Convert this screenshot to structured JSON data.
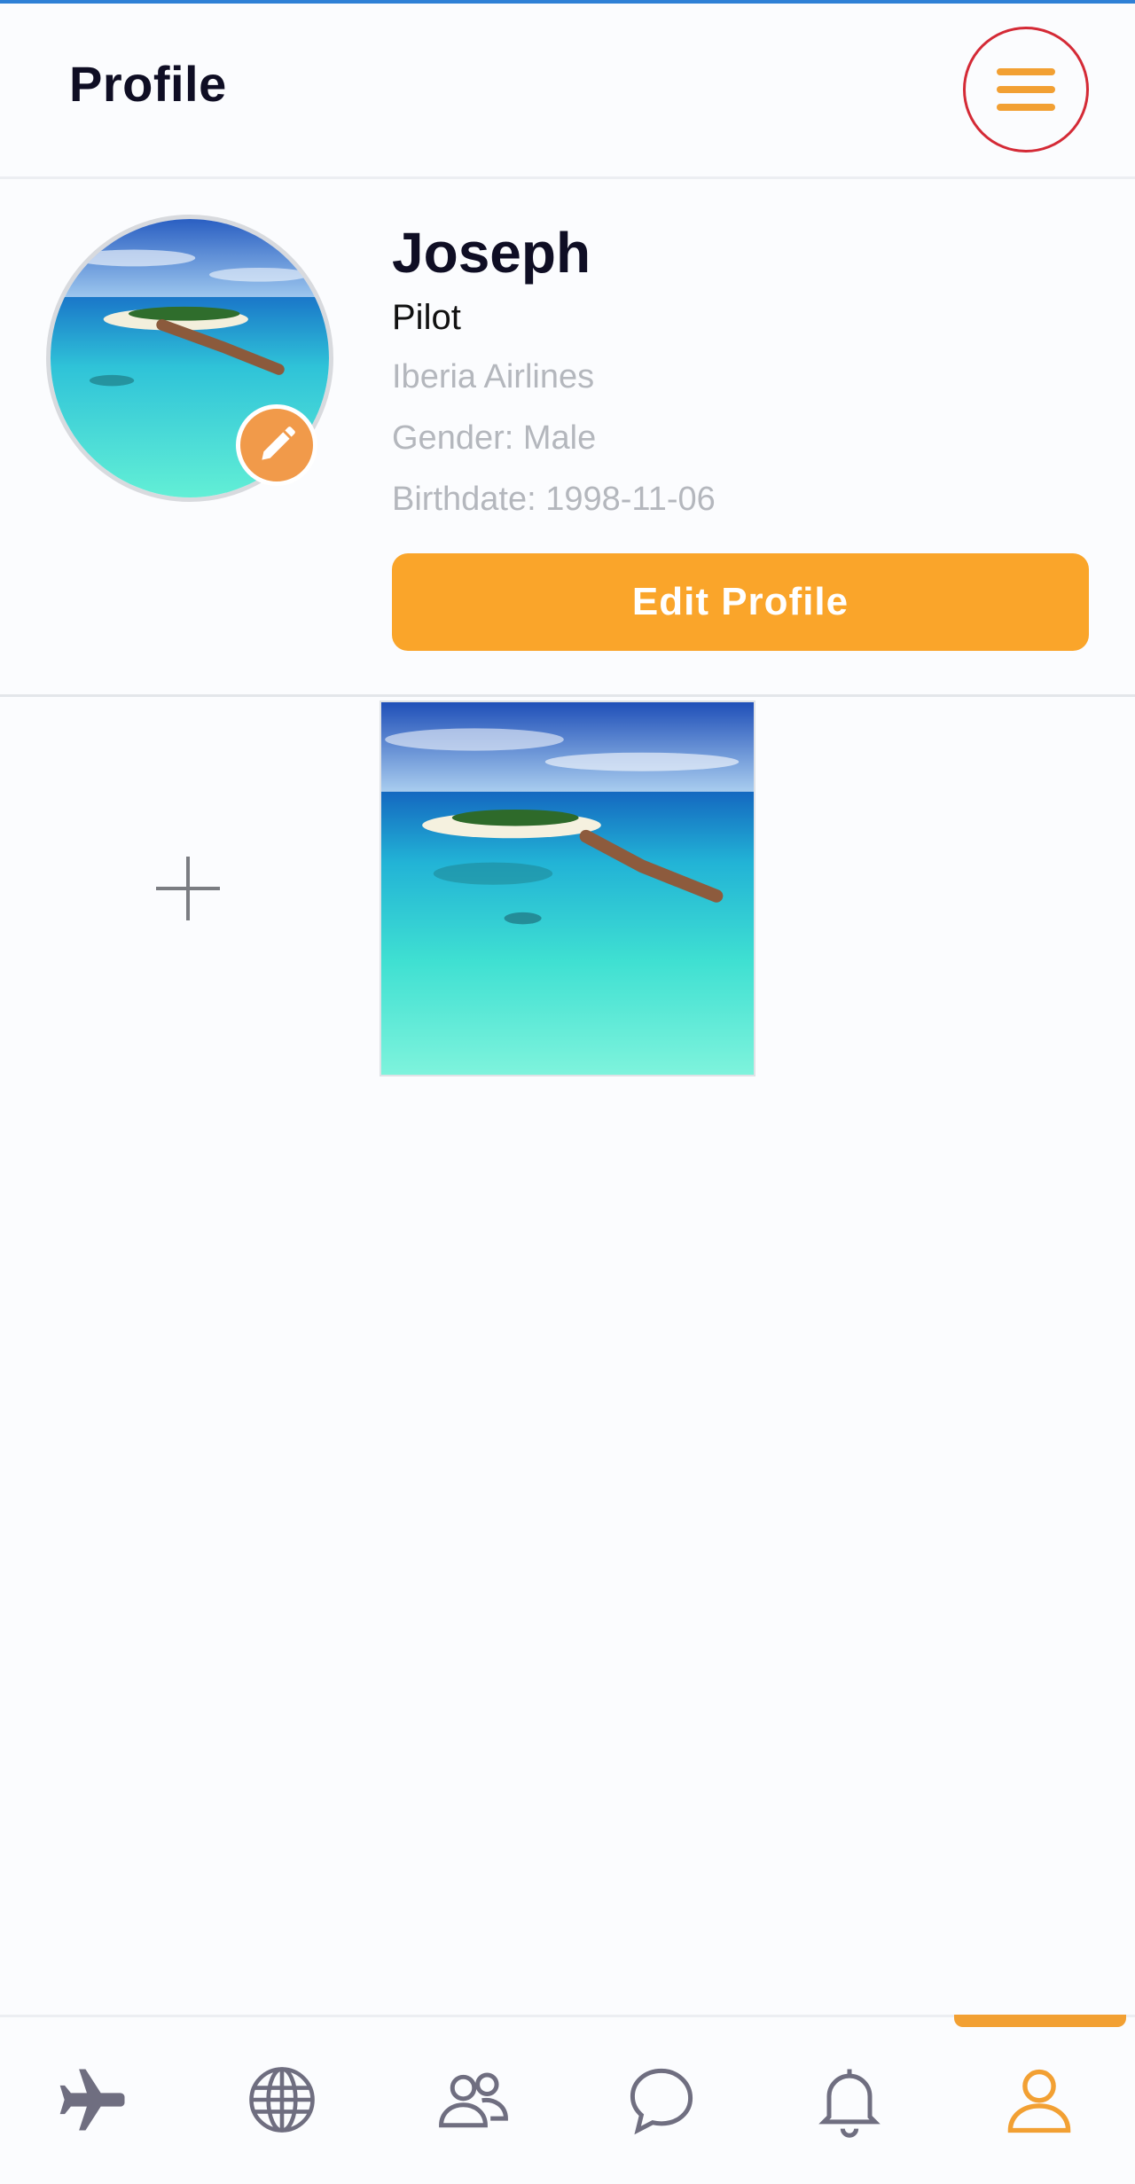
{
  "header": {
    "title": "Profile",
    "menu_icon": "hamburger-menu-icon"
  },
  "profile": {
    "name": "Joseph",
    "occupation": "Pilot",
    "airline": "Iberia Airlines",
    "gender": "Gender: Male",
    "birthdate": "Birthdate: 1998-11-06",
    "edit_button": "Edit Profile",
    "avatar_image": "island-resort-photo",
    "avatar_edit_icon": "pencil-icon"
  },
  "gallery": {
    "add_icon": "plus-icon",
    "photos": [
      "island-resort-photo"
    ]
  },
  "bottom_nav": {
    "items": [
      {
        "icon": "airplane-icon",
        "active": false
      },
      {
        "icon": "globe-icon",
        "active": false
      },
      {
        "icon": "people-icon",
        "active": false
      },
      {
        "icon": "chat-icon",
        "active": false
      },
      {
        "icon": "bell-icon",
        "active": false
      },
      {
        "icon": "user-icon",
        "active": true
      }
    ]
  },
  "colors": {
    "accent": "#faa52a",
    "menu_highlight": "#d42a36",
    "title": "#0f0e24",
    "muted_text": "#b4b7bd",
    "nav_inactive": "#6f6e80"
  }
}
